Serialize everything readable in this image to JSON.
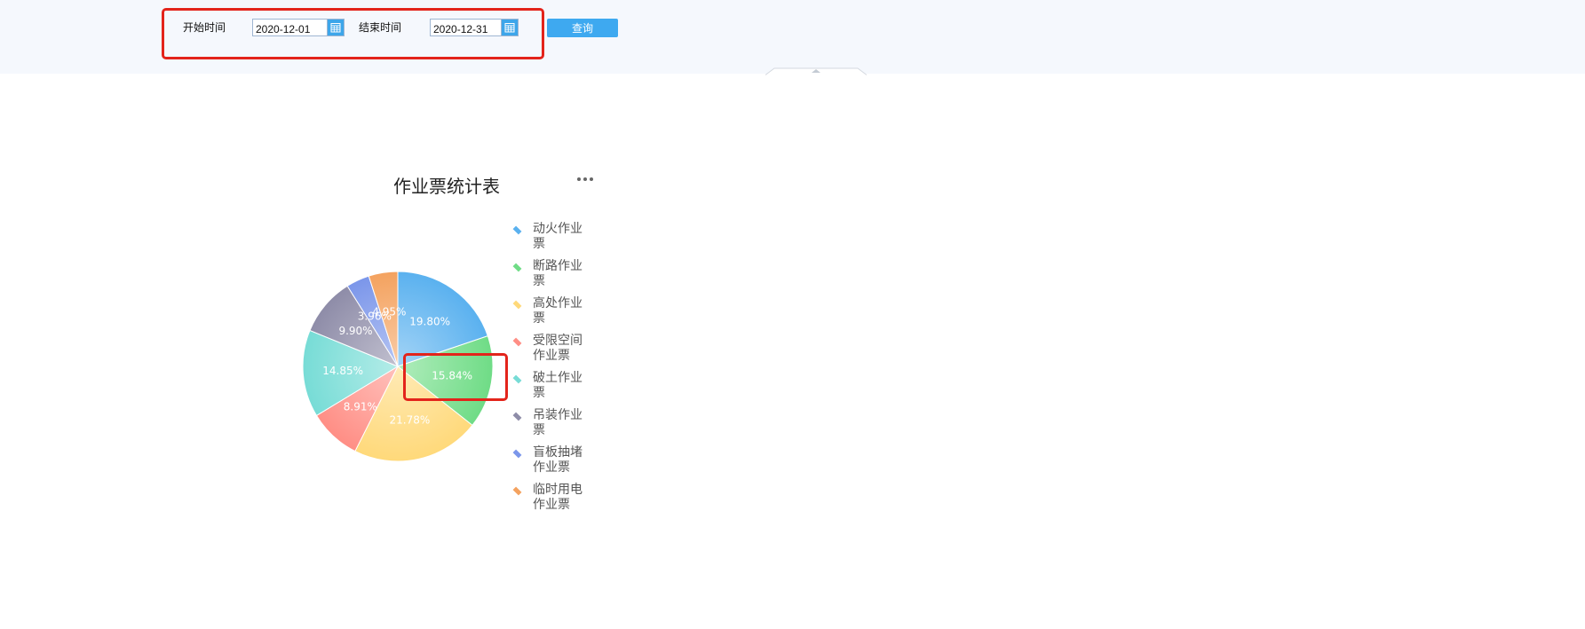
{
  "filter": {
    "start_label": "开始时间",
    "start_value": "2020-12-01",
    "end_label": "结束时间",
    "end_value": "2020-12-31",
    "query_label": "查询"
  },
  "chart_data": {
    "type": "pie",
    "title": "作业票统计表",
    "categories": [
      "动火作业票",
      "断路作业票",
      "高处作业票",
      "受限空间作业票",
      "破土作业票",
      "吊装作业票",
      "盲板抽堵作业票",
      "临时用电作业票"
    ],
    "values": [
      19.8,
      15.84,
      21.78,
      8.91,
      14.85,
      9.9,
      3.96,
      4.95
    ],
    "labels": [
      "19.80%",
      "15.84%",
      "21.78%",
      "8.91%",
      "14.85%",
      "9.90%",
      "3.96%",
      "4.95%"
    ],
    "colors": [
      "#5ab1ef",
      "#6fdc86",
      "#ffd97a",
      "#ff8e85",
      "#77dcd6",
      "#8e8ca8",
      "#7b96ea",
      "#f4a25f"
    ],
    "legend_position": "right"
  },
  "icons": {
    "calendar": "calendar-icon",
    "more": "more-icon",
    "collapse": "collapse-arrow-icon"
  },
  "annotation_color": "#e3241b"
}
